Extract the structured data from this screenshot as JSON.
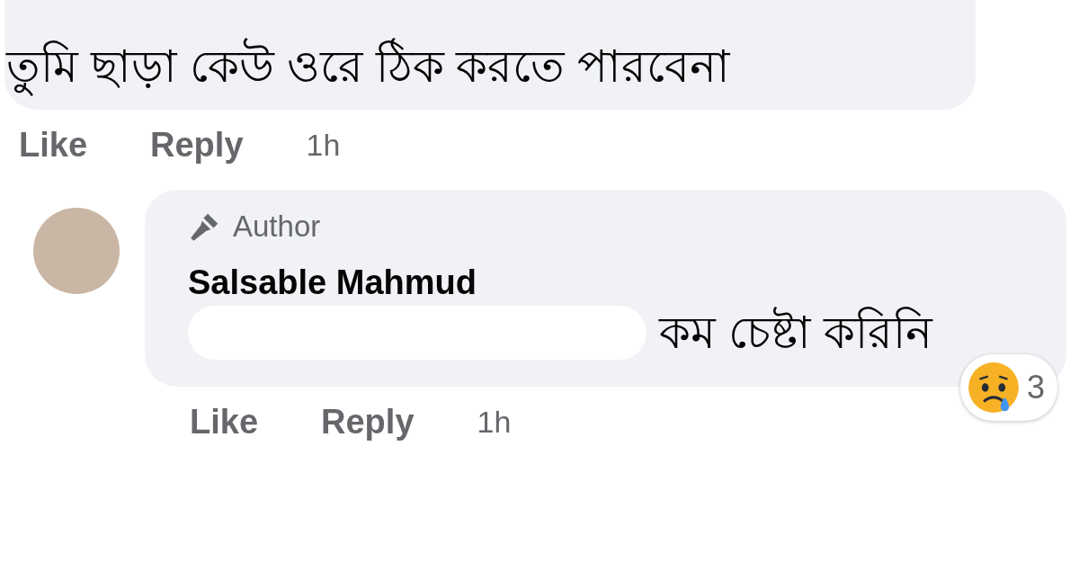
{
  "comments": [
    {
      "text": "তুমি ছাড়া কেউ ওরে ঠিক করতে পারবেনা",
      "redacted": false,
      "actions": [
        {
          "label": "Like"
        },
        {
          "label": "Reply"
        }
      ],
      "time": "1h"
    },
    {
      "author": "Salsable Mahmud",
      "badge": "Author",
      "text": "কম চেষ্টা করিনি",
      "redacted": true,
      "reaction": {
        "kind": "sad",
        "count": "3"
      },
      "actions": [
        {
          "label": "Like"
        },
        {
          "label": "Reply"
        }
      ],
      "time": "1h"
    }
  ]
}
